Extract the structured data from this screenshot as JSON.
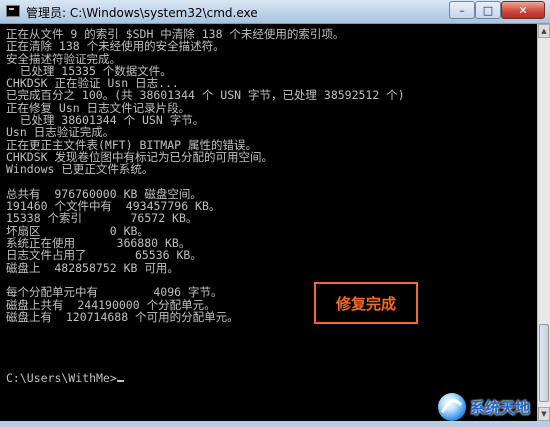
{
  "window": {
    "title": "管理员: C:\\Windows\\system32\\cmd.exe",
    "controls": {
      "minimize": "–",
      "maximize": "□",
      "close": "✕"
    }
  },
  "console": {
    "lines": [
      "正在从文件 9 的索引 $SDH 中清除 138 个未经使用的索引项。",
      "正在清除 138 个未经使用的安全描述符。",
      "安全描述符验证完成。",
      "  已处理 15335 个数据文件。",
      "CHKDSK 正在验证 Usn 日志...",
      "已完成百分之 100。(共 38601344 个 USN 字节，已处理 38592512 个)",
      "正在修复 Usn 日志文件记录片段。",
      "  已处理 38601344 个 USN 字节。",
      "Usn 日志验证完成。",
      "正在更正主文件表(MFT) BITMAP 属性的错误。",
      "CHKDSK 发现卷位图中有标记为已分配的可用空间。",
      "Windows 已更正文件系统。",
      "",
      "总共有  976760000 KB 磁盘空间。",
      "191460 个文件中有  493457796 KB。",
      "15338 个索引       76572 KB。",
      "坏扇区          0 KB。",
      "系统正在使用      366880 KB。",
      "日志文件占用了       65536 KB。",
      "磁盘上  482858752 KB 可用。",
      "",
      "每个分配单元中有        4096 字节。",
      "磁盘上共有  244190000 个分配单元。",
      "磁盘上有  120714688 个可用的分配单元。",
      "",
      "",
      "",
      ""
    ],
    "prompt": "C:\\Users\\WithMe>"
  },
  "annotation": {
    "label": "修复完成",
    "color": "#f06a2b"
  },
  "watermark": {
    "text": "系统天地",
    "icon": "site-logo-icon"
  }
}
